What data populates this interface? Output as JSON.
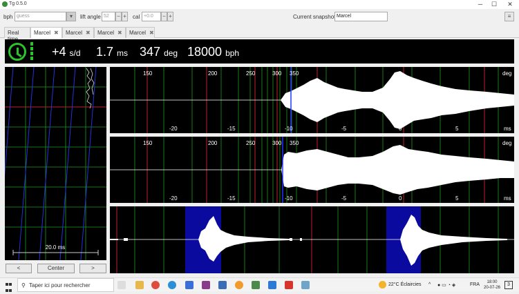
{
  "window": {
    "title": "Tg 0.5.0",
    "minimize": "─",
    "maximize": "☐",
    "close": "✕"
  },
  "toolbar": {
    "bph_label": "bph",
    "bph_placeholder": "guess",
    "bph_dropdown": "▾",
    "lift_label": "lift angle",
    "lift_value": "52",
    "lift_minus": "−",
    "lift_plus": "+",
    "cal_label": "cal",
    "cal_value": "+0.0",
    "cal_minus": "−",
    "cal_plus": "+",
    "snapshot_label": "Current snapshot:",
    "snapshot_value": "Marcel",
    "menu": "≡"
  },
  "tabs": [
    {
      "label": "Real time",
      "closable": false
    },
    {
      "label": "Marcel",
      "closable": true
    },
    {
      "label": "Marcel",
      "closable": true
    },
    {
      "label": "Marcel",
      "closable": true
    },
    {
      "label": "Marcel",
      "closable": true
    }
  ],
  "tab_close": "✖",
  "readout": {
    "rate": "+4",
    "rate_unit": "s/d",
    "beat_error": "1.7",
    "beat_error_unit": "ms",
    "amplitude": "347",
    "amplitude_unit": "deg",
    "bph": "18000",
    "bph_unit": "bph"
  },
  "paperstrip": {
    "scale_label": "20.0 ms"
  },
  "nav": {
    "left": "<",
    "center": "Center",
    "right": ">"
  },
  "waveform1": {
    "deg_ticks": [
      "150",
      "200",
      "250",
      "300",
      "350"
    ],
    "deg_unit": "deg",
    "ms_ticks": [
      "-20",
      "-15",
      "-10",
      "-5",
      "0",
      "5"
    ],
    "ms_unit": "ms"
  },
  "waveform2": {
    "deg_ticks": [
      "150",
      "200",
      "250",
      "300",
      "350"
    ],
    "deg_unit": "deg",
    "ms_ticks": [
      "-20",
      "-15",
      "-10",
      "-5",
      "0",
      "5"
    ],
    "ms_unit": "ms"
  },
  "taskbar": {
    "search_placeholder": "Taper ici pour rechercher",
    "weather": "22°C Éclaircies",
    "lang": "FRA",
    "time": "18:00",
    "date": "20-07-26",
    "notif_count": "3"
  },
  "colors": {
    "green": "#2cc42c",
    "red": "#c0202a",
    "blue": "#2233cc",
    "highlight": "#0a0a9e"
  }
}
